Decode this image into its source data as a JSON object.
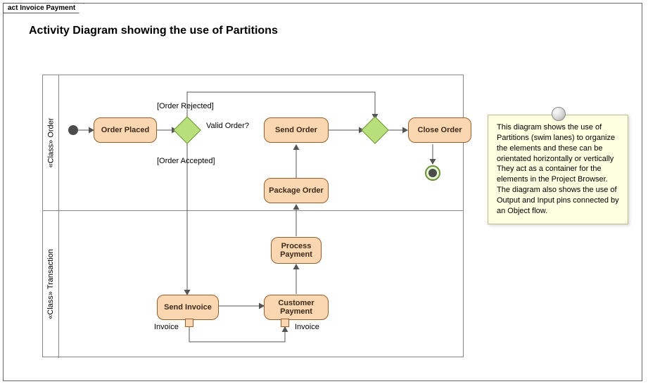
{
  "frame": {
    "tab": "act Invoice Payment",
    "title": "Activity Diagram showing the use of Partitions"
  },
  "partitions": {
    "top": "«Class» Order",
    "bottom": "«Class» Transaction"
  },
  "activities": {
    "orderPlaced": "Order Placed",
    "sendOrder": "Send Order",
    "closeOrder": "Close Order",
    "packageOrder": "Package Order",
    "processPayment": "Process Payment",
    "sendInvoice": "Send Invoice",
    "customerPayment": "Customer Payment"
  },
  "decisions": {
    "validOrder": "Valid Order?"
  },
  "guards": {
    "rejected": "[Order Rejected]",
    "accepted": "[Order Accepted]"
  },
  "pins": {
    "invoiceOut": "Invoice",
    "invoiceIn": "Invoice"
  },
  "note": {
    "text": "This diagram shows the use of Partitions (swim lanes) to organize the elements and these can be orientated horizontally or vertically  They act as a container for the elements in the Project Browser. The diagram also shows the use of Output and Input pins connected by an Object flow."
  }
}
